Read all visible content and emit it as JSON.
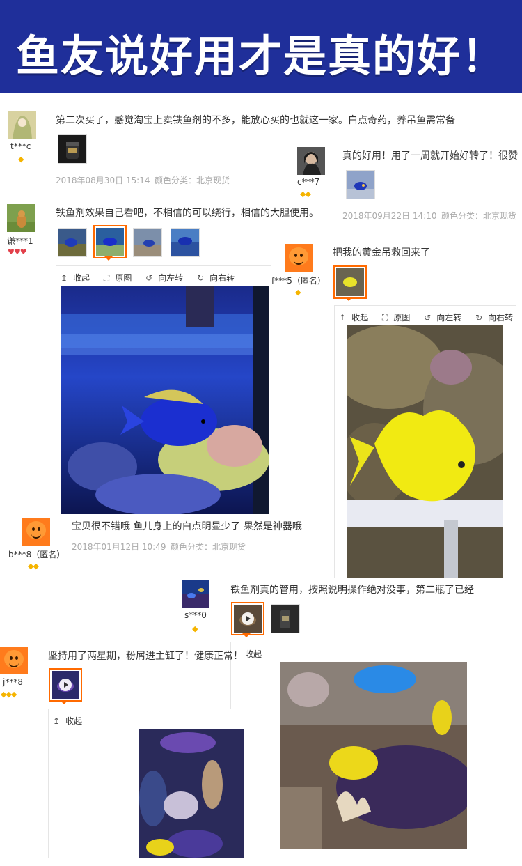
{
  "banner": {
    "title": "鱼友说好用才是真的好！"
  },
  "toolbar": {
    "collapse": "收起",
    "original": "原图",
    "rotate_left": "向左转",
    "rotate_right": "向右转",
    "collapse_icon": "↥",
    "original_icon": "⛶",
    "rotate_left_icon": "↺",
    "rotate_right_icon": "↻"
  },
  "reviews": [
    {
      "user": "t***c",
      "stars": "◆",
      "text": "第二次买了，感觉淘宝上卖铁鱼剂的不多，能放心买的也就这一家。白点奇药，养吊鱼需常备",
      "date": "2018年08月30日 15:14",
      "category": "颜色分类：北京现货"
    },
    {
      "user": "c***7",
      "stars": "◆◆",
      "text": "真的好用！用了一周就开始好转了！很赞",
      "date": "2018年09月22日 14:10",
      "category": "颜色分类：北京现货"
    },
    {
      "user": "谦***1",
      "stars": "♥♥♥",
      "text": "铁鱼剂效果自己看吧，不相信的可以绕行，相信的大胆使用。"
    },
    {
      "user": "f***5（匿名）",
      "stars": "◆",
      "text": "把我的黄金吊救回来了"
    },
    {
      "user": "b***8（匿名）",
      "stars": "◆◆",
      "text": "宝贝很不错哦 鱼儿身上的白点明显少了 果然是神器哦",
      "date": "2018年01月12日 10:49",
      "category": "颜色分类：北京现货"
    },
    {
      "user": "s***0",
      "stars": "◆",
      "text": "铁鱼剂真的管用，按照说明操作绝对没事，第二瓶了已经"
    },
    {
      "user": "j***8",
      "stars": "◆◆◆",
      "text": "坚持用了两星期，粉屑进主缸了！健康正常！"
    }
  ],
  "colors": {
    "banner": "#1f2f9a",
    "accent": "#ff6a00",
    "star": "#f5b400"
  }
}
